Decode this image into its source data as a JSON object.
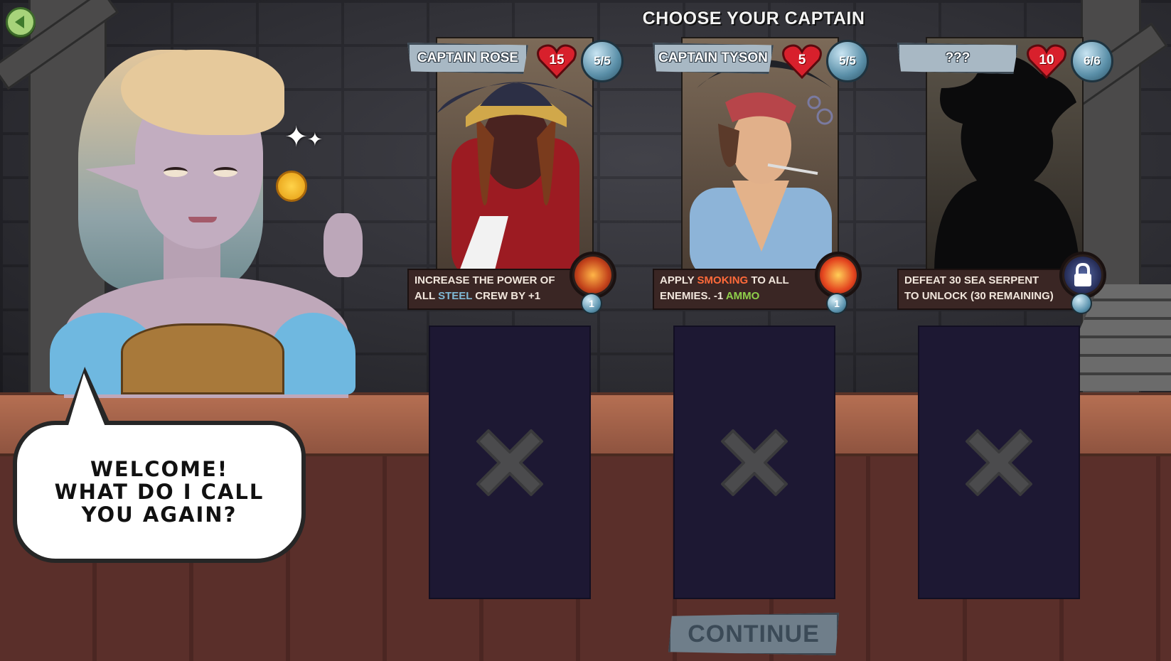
{
  "screen": {
    "title": "CHOOSE YOUR CAPTAIN",
    "continue_label": "CONTINUE"
  },
  "dialog": {
    "text": "WELCOME!\nWHAT DO I CALL\nYOU AGAIN?"
  },
  "captains": [
    {
      "name": "CAPTAIN ROSE",
      "health": "15",
      "crew": "5/5",
      "ability_parts": [
        "INCREASE THE POWER OF ALL ",
        "STEEL",
        " CREW BY +1"
      ],
      "ability_icon": "chain-icon",
      "cost": "1"
    },
    {
      "name": "CAPTAIN TYSON",
      "health": "5",
      "crew": "5/5",
      "ability_parts": [
        "APPLY ",
        "SMOKING",
        " TO ALL ENEMIES. -1 ",
        "AMMO"
      ],
      "ability_icon": "fire-icon",
      "cost": "1"
    },
    {
      "name": "???",
      "health": "10",
      "crew": "6/6",
      "ability_text": "DEFEAT 30 SEA SERPENT TO UNLOCK (30 REMAINING)",
      "ability_icon": "lock-icon",
      "locked": true
    }
  ],
  "crew_slots": [
    {
      "state": "empty"
    },
    {
      "state": "empty"
    },
    {
      "state": "empty"
    }
  ],
  "colors": {
    "health_heart": "#d8202c",
    "crew_orb": "#5a8fa8",
    "slot_bg": "#1d1833",
    "steel": "#7fb9d6",
    "smoking": "#ff6a3a",
    "ammo": "#8fd04b",
    "back_button": "#a7d37a"
  }
}
